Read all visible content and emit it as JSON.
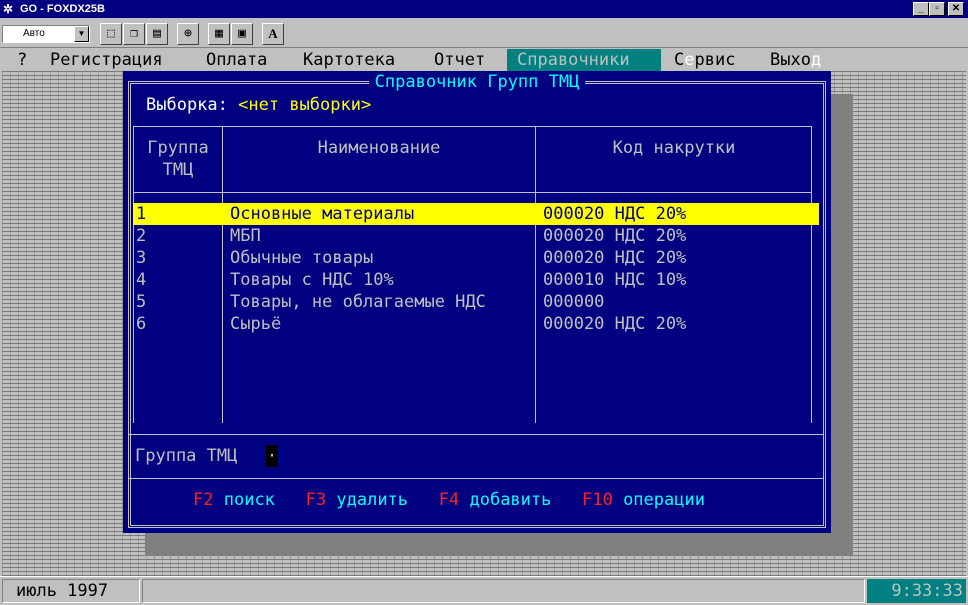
{
  "window": {
    "title": "GO - FOXDX25B",
    "minimize": "_",
    "maximize": "▫",
    "close": "✕"
  },
  "toolbar": {
    "mode_value": "Авто",
    "font_button": "A"
  },
  "menu": {
    "help": "?",
    "items": [
      "Регистрация",
      "Оплата",
      "Картотека",
      "Отчет",
      "Справочники"
    ],
    "service_prefix": "С",
    "service_faded": "е",
    "service_rest": "рвис",
    "exit_main": "Выхо",
    "exit_faded": "д"
  },
  "dialog": {
    "title": "Справочник Групп ТМЦ",
    "selection_label": "Выборка:",
    "selection_value": "<нет выборки>",
    "columns": {
      "group_line1": "Группа",
      "group_line2": "ТМЦ",
      "name": "Наименование",
      "markup": "Код накрутки"
    },
    "rows": [
      {
        "code": "1",
        "name": "Основные материалы",
        "markup": "000020 НДС 20%"
      },
      {
        "code": "2",
        "name": "МБП",
        "markup": "000020 НДС 20%"
      },
      {
        "code": "3",
        "name": "Обычные товары",
        "markup": "000020 НДС 20%"
      },
      {
        "code": "4",
        "name": "Товары с НДС 10%",
        "markup": "000010 НДС 10%"
      },
      {
        "code": "5",
        "name": "Товары, не облагаемые НДС",
        "markup": "000000"
      },
      {
        "code": "6",
        "name": "Сырьё",
        "markup": "000020 НДС 20%"
      }
    ],
    "field_label": "Группа ТМЦ",
    "field_value": "·",
    "hotkeys": [
      {
        "key": "F2",
        "label": "поиск"
      },
      {
        "key": "F3",
        "label": "удалить"
      },
      {
        "key": "F4",
        "label": "добавить"
      },
      {
        "key": "F10",
        "label": "операции"
      }
    ]
  },
  "status": {
    "date": "июль 1997",
    "clock": "9:33:33"
  }
}
